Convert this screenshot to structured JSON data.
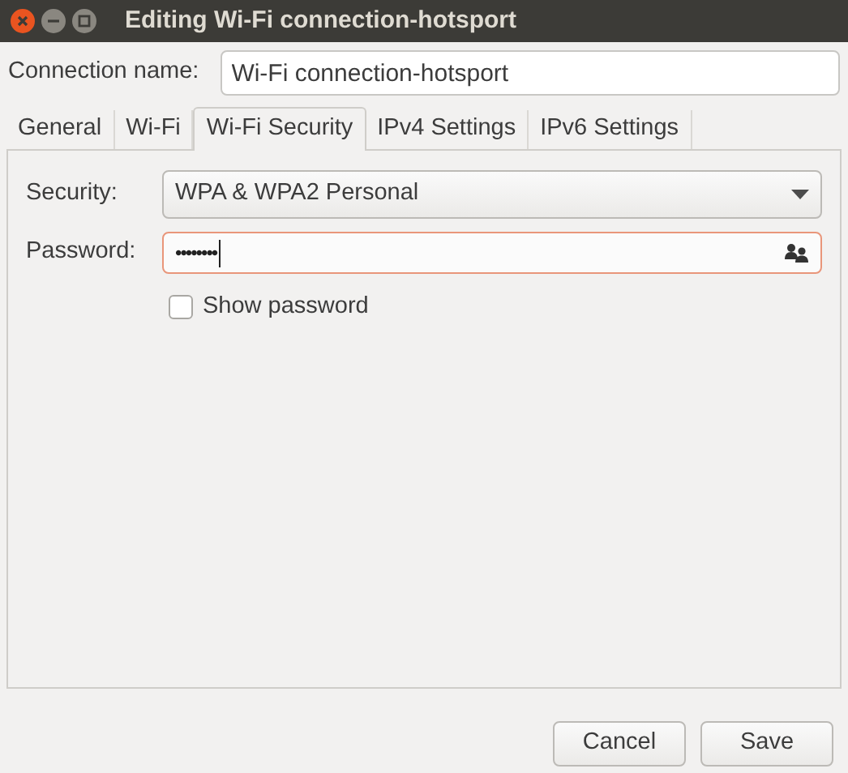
{
  "window": {
    "title": "Editing Wi-Fi connection-hotsport"
  },
  "connection_name": {
    "label": "Connection name:",
    "value": "Wi-Fi connection-hotsport"
  },
  "tabs": [
    {
      "label": "General",
      "selected": false
    },
    {
      "label": "Wi-Fi",
      "selected": false
    },
    {
      "label": "Wi-Fi Security",
      "selected": true
    },
    {
      "label": "IPv4 Settings",
      "selected": false
    },
    {
      "label": "IPv6 Settings",
      "selected": false
    }
  ],
  "security": {
    "label": "Security:",
    "value": "WPA & WPA2 Personal"
  },
  "password": {
    "label": "Password:",
    "value": "••••••••",
    "focused": true
  },
  "show_password": {
    "label": "Show password",
    "checked": false
  },
  "buttons": [
    "Cancel",
    "Save"
  ]
}
